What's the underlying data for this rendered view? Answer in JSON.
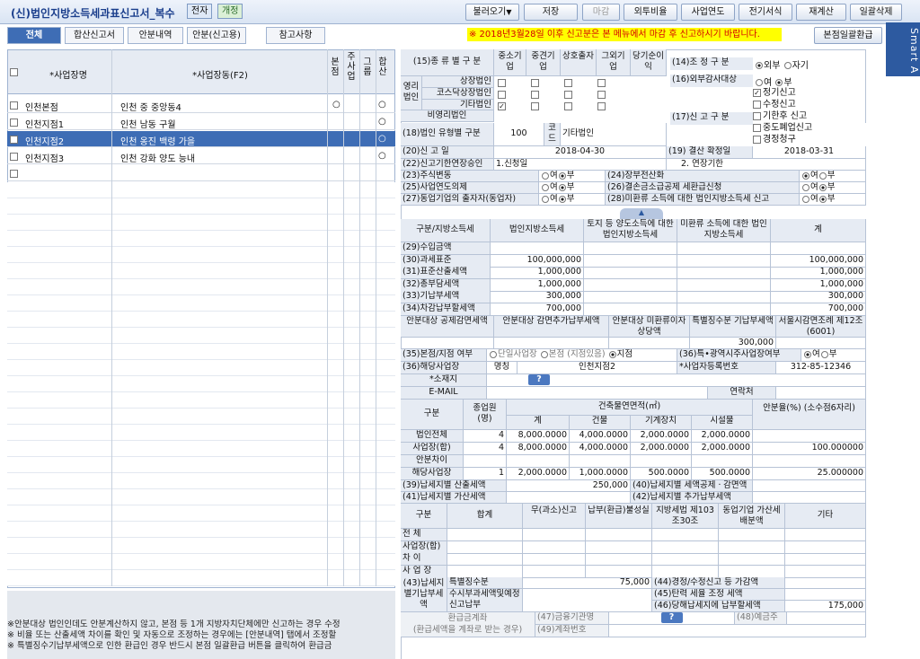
{
  "header": {
    "title": "(신)법인지방소득세과표신고서_복수",
    "tag1": "전자",
    "tag2": "개정",
    "buttons": [
      "불러오기",
      "저장",
      "마감",
      "외투비율",
      "사업연도",
      "전기서식",
      "재계산",
      "일괄삭제"
    ],
    "dropdown_arrow": "▼"
  },
  "tabs": [
    "전체",
    "합산신고서",
    "안분내역",
    "안분(신고용)",
    "참고사항"
  ],
  "notice": "※ 2018년3월28일 이후 신고분은 본 메뉴에서 마감 후 신고하시기 바랍니다.",
  "batch_btn": "본점일괄환급",
  "smart": "Smart A",
  "list": {
    "headers": {
      "name": "*사업장명",
      "addr": "*사업장동(F2)",
      "c1": "본점",
      "c2": "주사업",
      "c3": "그룹",
      "c4": "합산"
    },
    "rows": [
      {
        "name": "인천본점",
        "addr": "인천 중 중앙동4",
        "c1": "○",
        "c4": "○"
      },
      {
        "name": "인천지점1",
        "addr": "인천 남동 구월",
        "c4": "○"
      },
      {
        "name": "인천지점2",
        "addr": "인천 옹진 백령 가을",
        "c4": "○"
      },
      {
        "name": "인천지점3",
        "addr": "인천 강화 양도 능내",
        "c4": "○"
      }
    ]
  },
  "notes": [
    "※안분대상 법인인데도 안분계산하지 않고, 본점 등 1개 지방자치단체에만 신고하는 경우 수정",
    "※ 비율 또는 산출세액 차이를 확인 및 자동으로 조정하는 경우에는 [안분내역] 탭에서 조정할",
    "※ 특별징수기납부세액으로 인한 환급인 경우 반드시 본점 일괄환급 버튼을 클릭하여 환급금"
  ],
  "form": {
    "s15": "(15)종 류 별 구 분",
    "cols15": [
      "중소기업",
      "중견기업",
      "상호출자",
      "그외기업",
      "당기순이익"
    ],
    "corp": "영리법인",
    "rows15": [
      "상장법인",
      "코스닥상장법인",
      "기타법인"
    ],
    "nonprofit": "비영리법인",
    "s14": "(14)조 정 구 분",
    "s14o": [
      "외부",
      "자기"
    ],
    "s16": "(16)외부감사대상",
    "s16o": [
      "여",
      "부"
    ],
    "s17": "(17)신 고 구 분",
    "s17o": [
      "정기신고",
      "수정신고",
      "기한후 신고",
      "중도폐업신고",
      "경정청구"
    ],
    "s18": "(18)법인 유형별 구분",
    "s18v": "100",
    "s18c": "코드",
    "s18n": "기타법인",
    "s20": "(20)신 고 일",
    "s20v": "2018-04-30",
    "s19": "(19) 결산 확정일",
    "s19v": "2018-03-31",
    "s22": "(22)신고기한연장승인",
    "s22a": "1.신청일",
    "s22b": "2. 연장기한",
    "yn": [
      "(23)주식변동",
      "(24)장부전산화",
      "(25)사업연도의제",
      "(26)결손금소급공제 세환급신청",
      "(27)동업기업의 출자자(동업자)",
      "(28)미환류 소득에 대한 법인지방소득세 신고"
    ],
    "ynopt": [
      "여",
      "부"
    ],
    "t1h": [
      "구분/지방소득세",
      "법인지방소득세",
      "토지 등 양도소득에 대한 법인지방소득세",
      "미환류 소득에 대한 법인지방소득세",
      "계"
    ],
    "t1": [
      {
        "k": "(29)수입금액",
        "a": "",
        "d": ""
      },
      {
        "k": "(30)과세표준",
        "a": "100,000,000",
        "d": "100,000,000"
      },
      {
        "k": "(31)표준산출세액",
        "a": "1,000,000",
        "d": "1,000,000"
      },
      {
        "k": "(32)총부담세액",
        "a": "1,000,000",
        "d": "1,000,000"
      },
      {
        "k": "(33)기납부세액",
        "a": "300,000",
        "d": "300,000"
      },
      {
        "k": "(34)차감납부할세액",
        "a": "700,000",
        "d": "700,000"
      }
    ],
    "t2h": [
      "안분대상 공제감면세액",
      "안분대상 감면추가납부세액",
      "안분대상 미환류이자상당액",
      "특별징수분 기납부세액",
      "서울시감면조례 제12조(6001)"
    ],
    "t2v": "300,000",
    "s35": "(35)본점/지점 여부",
    "s35o": [
      "단일사업장",
      "본점 (지점있음)",
      "지점"
    ],
    "s36b": "(36)특•광역시주사업장여부",
    "s36bo": [
      "여",
      "부"
    ],
    "s36": "(36)해당사업장",
    "name_l": "명칭",
    "name_v": "인천지점2",
    "reg_l": "*사업자등록번호",
    "reg_v": "312-85-12346",
    "addr_l": "*소재지",
    "q": "?",
    "email_l": "E-MAIL",
    "tel_l": "연락처",
    "t3h": [
      "구분",
      "종업원 (명)",
      "건축물연면적(㎡)",
      "계",
      "건물",
      "기계장치",
      "시설물",
      "안분율(%) (소수점6자리)"
    ],
    "t3": [
      {
        "k": "법인전체",
        "e": "4",
        "t": "8,000.0000",
        "b": "4,000.0000",
        "m": "2,000.0000",
        "f": "2,000.0000",
        "r": ""
      },
      {
        "k": "사업장(합)",
        "e": "4",
        "t": "8,000.0000",
        "b": "4,000.0000",
        "m": "2,000.0000",
        "f": "2,000.0000",
        "r": "100.000000"
      },
      {
        "k": "안분차이",
        "e": "",
        "t": "",
        "b": "",
        "m": "",
        "f": "",
        "r": ""
      },
      {
        "k": "해당사업장",
        "e": "1",
        "t": "2,000.0000",
        "b": "1,000.0000",
        "m": "500.0000",
        "f": "500.0000",
        "r": "25.000000"
      }
    ],
    "s39": "(39)납세지별 산출세액",
    "s39v": "250,000",
    "s40": "(40)납세지별 세액공제ㆍ감면액",
    "s41": "(41)납세지별 가산세액",
    "s42": "(42)납세지별 추가납부세액",
    "t4h": [
      "구분",
      "합계",
      "무(과소)신고",
      "납부(환급)불성실",
      "지방세법 제103조30조",
      "동업기업 가산세배분액",
      "기타"
    ],
    "t4": [
      "전 체",
      "사업장(합)",
      "차 이",
      "사 업 장"
    ],
    "s43": "(43)납세지별기납부세액",
    "s43a": "특별징수분",
    "s43av": "75,000",
    "s43b": "수시부과세액및예정신고납부",
    "s44": "(44)경정/수정신고 등 가감액",
    "s45": "(45)탄력 세율 조정 세액",
    "s46": "(46)당해납세지에 납부할세액",
    "s46v": "175,000",
    "refund": "환급금계좌",
    "refund2": "(환급세액을 계좌로 받는 경우)",
    "s47": "(47)금융기관명",
    "s48": "(48)예금주",
    "s49": "(49)계좌번호"
  }
}
